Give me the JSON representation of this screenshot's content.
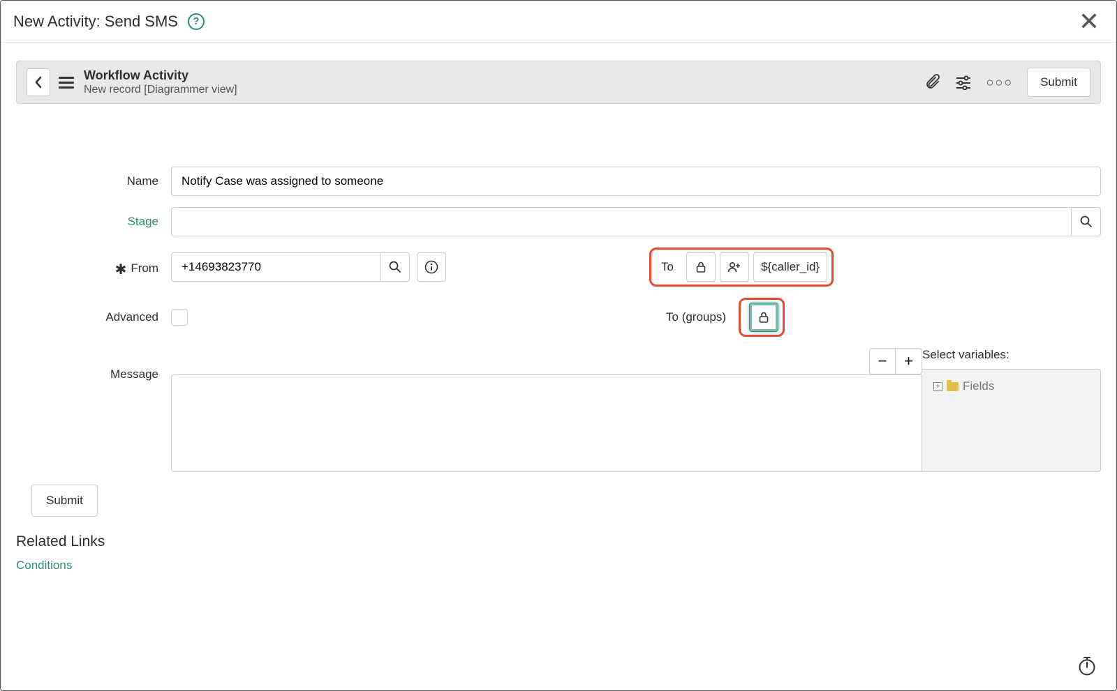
{
  "dialog": {
    "title": "New Activity: Send SMS"
  },
  "formHeader": {
    "title": "Workflow Activity",
    "subtitle": "New record [Diagrammer view]",
    "submit": "Submit"
  },
  "labels": {
    "name": "Name",
    "stage": "Stage",
    "from": "From",
    "to": "To",
    "advanced": "Advanced",
    "to_groups": "To (groups)",
    "message": "Message",
    "select_variables": "Select variables:",
    "fields": "Fields",
    "submit": "Submit",
    "related_links": "Related Links",
    "conditions": "Conditions"
  },
  "values": {
    "name": "Notify Case was assigned to someone",
    "stage": "",
    "from": "+14693823770",
    "to": "${caller_id}",
    "message": ""
  },
  "icons": {
    "minus": "−",
    "plus": "+"
  }
}
